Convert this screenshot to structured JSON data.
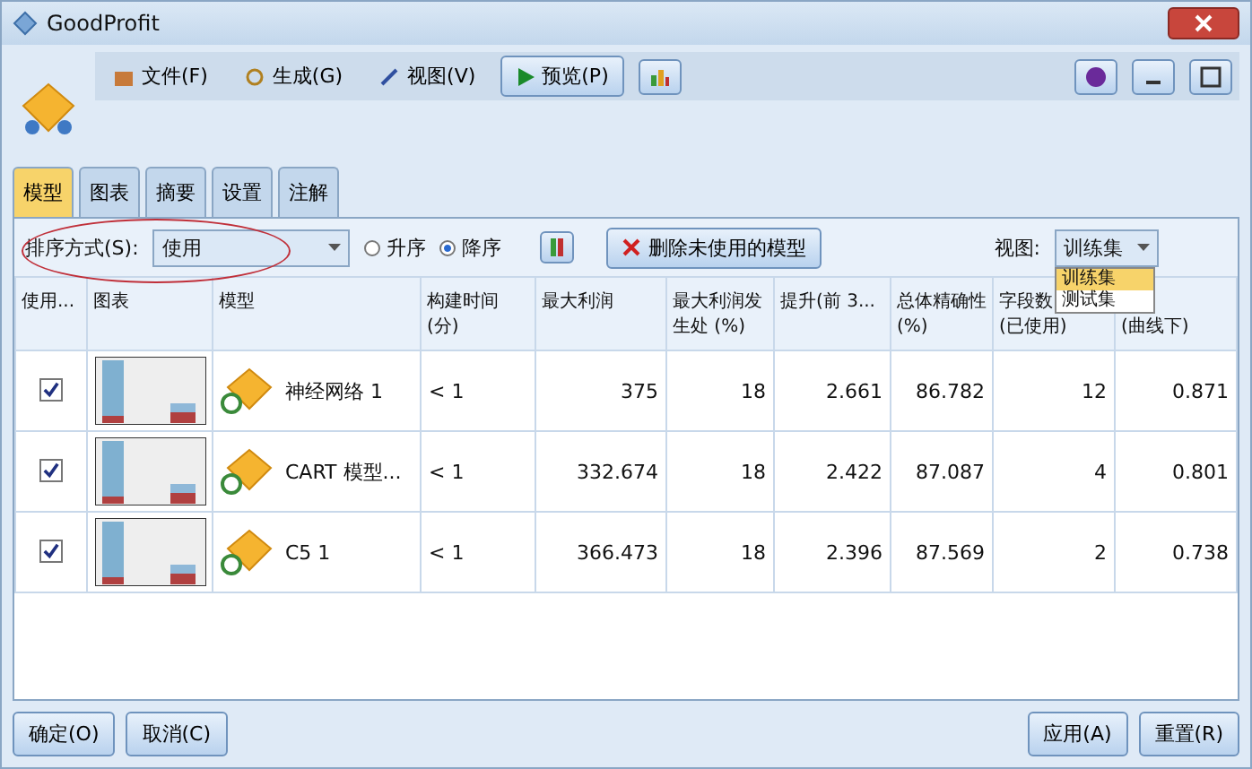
{
  "window": {
    "title": "GoodProfit"
  },
  "menu": [
    {
      "label": "文件(F)",
      "kind": "file"
    },
    {
      "label": "生成(G)",
      "kind": "generate"
    },
    {
      "label": "视图(V)",
      "kind": "view"
    }
  ],
  "preview_button": "预览(P)",
  "tabs": [
    {
      "label": "模型",
      "selected": true
    },
    {
      "label": "图表",
      "selected": false
    },
    {
      "label": "摘要",
      "selected": false
    },
    {
      "label": "设置",
      "selected": false
    },
    {
      "label": "注解",
      "selected": false
    }
  ],
  "sort": {
    "label": "排序方式(S):",
    "value": "使用",
    "options": [
      {
        "label": "升序",
        "selected": false
      },
      {
        "label": "降序",
        "selected": true
      }
    ]
  },
  "delete_button": "删除未使用的模型",
  "view": {
    "label": "视图:",
    "value": "训练集",
    "options": [
      {
        "label": "训练集",
        "selected": true
      },
      {
        "label": "测试集",
        "selected": false
      }
    ]
  },
  "table": {
    "columns": [
      "使用...",
      "图表",
      "模型",
      "构建时间 (分)",
      "最大利润",
      "最大利润发生处 (%)",
      "提升(前 3...",
      "总体精确性 (%)",
      "字段数\n(已使用)",
      "\n(曲线下)"
    ],
    "rows": [
      {
        "use": true,
        "model": "神经网络 1",
        "build_time": "< 1",
        "max_profit": "375",
        "max_profit_at": "18",
        "lift": "2.661",
        "accuracy": "86.782",
        "fields": "12",
        "auc": "0.871"
      },
      {
        "use": true,
        "model": "CART 模型...",
        "build_time": "< 1",
        "max_profit": "332.674",
        "max_profit_at": "18",
        "lift": "2.422",
        "accuracy": "87.087",
        "fields": "4",
        "auc": "0.801"
      },
      {
        "use": true,
        "model": "C5 1",
        "build_time": "< 1",
        "max_profit": "366.473",
        "max_profit_at": "18",
        "lift": "2.396",
        "accuracy": "87.569",
        "fields": "2",
        "auc": "0.738"
      }
    ]
  },
  "footer_left": [
    "确定(O)",
    "取消(C)"
  ],
  "footer_right": [
    "应用(A)",
    "重置(R)"
  ]
}
